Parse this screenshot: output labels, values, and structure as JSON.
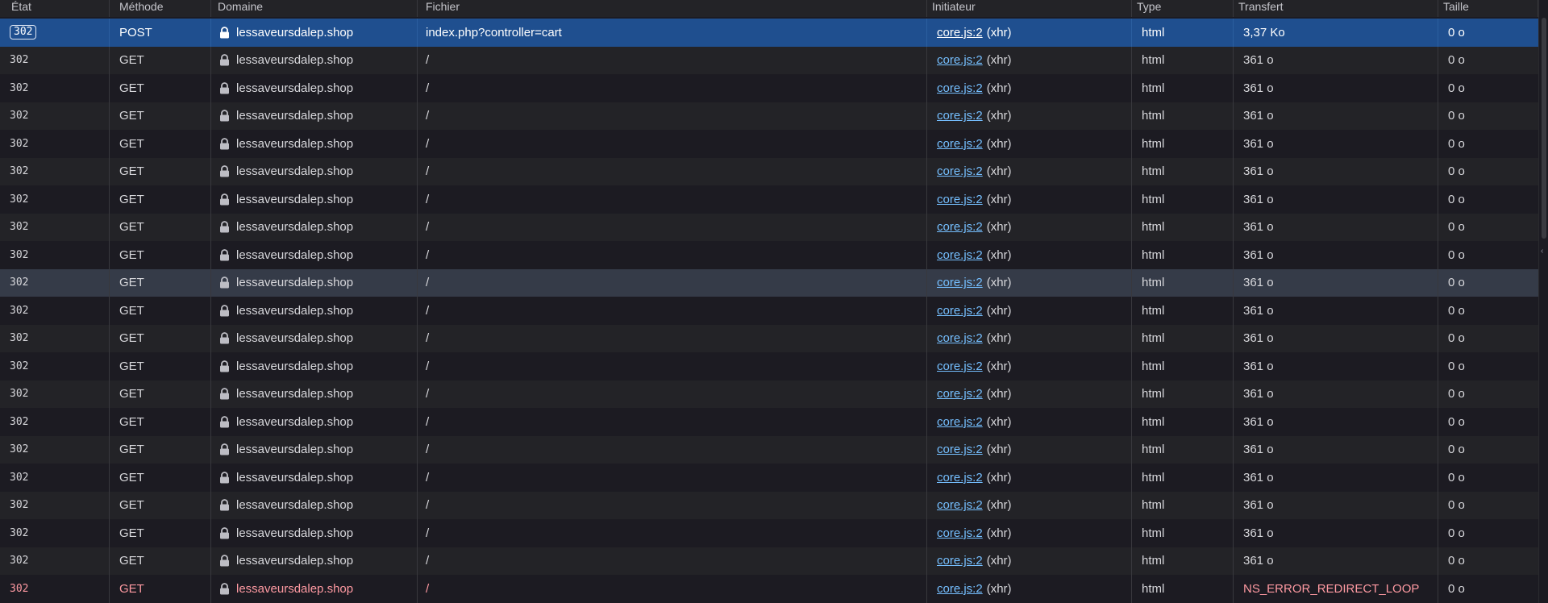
{
  "columns": {
    "status": "État",
    "method": "Méthode",
    "domain": "Domaine",
    "file": "Fichier",
    "initiator": "Initiateur",
    "type": "Type",
    "transfer": "Transfert",
    "size": "Taille"
  },
  "icons": {
    "lock": "lock-icon",
    "scroll_arrow": "chevron-left-icon"
  },
  "colors": {
    "selected_row": "#1f4f8f",
    "link": "#75bfff",
    "error_text": "#ff9aa2"
  },
  "requests": [
    {
      "status": "302",
      "method": "POST",
      "domain": "lessaveursdalep.shop",
      "file": "index.php?controller=cart",
      "initiator_link": "core.js:2",
      "initiator_kind": "(xhr)",
      "type": "html",
      "transfer": "3,37 Ko",
      "size": "0 o",
      "state": "selected"
    },
    {
      "status": "302",
      "method": "GET",
      "domain": "lessaveursdalep.shop",
      "file": "/",
      "initiator_link": "core.js:2",
      "initiator_kind": "(xhr)",
      "type": "html",
      "transfer": "361 o",
      "size": "0 o",
      "state": ""
    },
    {
      "status": "302",
      "method": "GET",
      "domain": "lessaveursdalep.shop",
      "file": "/",
      "initiator_link": "core.js:2",
      "initiator_kind": "(xhr)",
      "type": "html",
      "transfer": "361 o",
      "size": "0 o",
      "state": ""
    },
    {
      "status": "302",
      "method": "GET",
      "domain": "lessaveursdalep.shop",
      "file": "/",
      "initiator_link": "core.js:2",
      "initiator_kind": "(xhr)",
      "type": "html",
      "transfer": "361 o",
      "size": "0 o",
      "state": ""
    },
    {
      "status": "302",
      "method": "GET",
      "domain": "lessaveursdalep.shop",
      "file": "/",
      "initiator_link": "core.js:2",
      "initiator_kind": "(xhr)",
      "type": "html",
      "transfer": "361 o",
      "size": "0 o",
      "state": ""
    },
    {
      "status": "302",
      "method": "GET",
      "domain": "lessaveursdalep.shop",
      "file": "/",
      "initiator_link": "core.js:2",
      "initiator_kind": "(xhr)",
      "type": "html",
      "transfer": "361 o",
      "size": "0 o",
      "state": ""
    },
    {
      "status": "302",
      "method": "GET",
      "domain": "lessaveursdalep.shop",
      "file": "/",
      "initiator_link": "core.js:2",
      "initiator_kind": "(xhr)",
      "type": "html",
      "transfer": "361 o",
      "size": "0 o",
      "state": ""
    },
    {
      "status": "302",
      "method": "GET",
      "domain": "lessaveursdalep.shop",
      "file": "/",
      "initiator_link": "core.js:2",
      "initiator_kind": "(xhr)",
      "type": "html",
      "transfer": "361 o",
      "size": "0 o",
      "state": ""
    },
    {
      "status": "302",
      "method": "GET",
      "domain": "lessaveursdalep.shop",
      "file": "/",
      "initiator_link": "core.js:2",
      "initiator_kind": "(xhr)",
      "type": "html",
      "transfer": "361 o",
      "size": "0 o",
      "state": ""
    },
    {
      "status": "302",
      "method": "GET",
      "domain": "lessaveursdalep.shop",
      "file": "/",
      "initiator_link": "core.js:2",
      "initiator_kind": "(xhr)",
      "type": "html",
      "transfer": "361 o",
      "size": "0 o",
      "state": "hover"
    },
    {
      "status": "302",
      "method": "GET",
      "domain": "lessaveursdalep.shop",
      "file": "/",
      "initiator_link": "core.js:2",
      "initiator_kind": "(xhr)",
      "type": "html",
      "transfer": "361 o",
      "size": "0 o",
      "state": ""
    },
    {
      "status": "302",
      "method": "GET",
      "domain": "lessaveursdalep.shop",
      "file": "/",
      "initiator_link": "core.js:2",
      "initiator_kind": "(xhr)",
      "type": "html",
      "transfer": "361 o",
      "size": "0 o",
      "state": ""
    },
    {
      "status": "302",
      "method": "GET",
      "domain": "lessaveursdalep.shop",
      "file": "/",
      "initiator_link": "core.js:2",
      "initiator_kind": "(xhr)",
      "type": "html",
      "transfer": "361 o",
      "size": "0 o",
      "state": ""
    },
    {
      "status": "302",
      "method": "GET",
      "domain": "lessaveursdalep.shop",
      "file": "/",
      "initiator_link": "core.js:2",
      "initiator_kind": "(xhr)",
      "type": "html",
      "transfer": "361 o",
      "size": "0 o",
      "state": ""
    },
    {
      "status": "302",
      "method": "GET",
      "domain": "lessaveursdalep.shop",
      "file": "/",
      "initiator_link": "core.js:2",
      "initiator_kind": "(xhr)",
      "type": "html",
      "transfer": "361 o",
      "size": "0 o",
      "state": ""
    },
    {
      "status": "302",
      "method": "GET",
      "domain": "lessaveursdalep.shop",
      "file": "/",
      "initiator_link": "core.js:2",
      "initiator_kind": "(xhr)",
      "type": "html",
      "transfer": "361 o",
      "size": "0 o",
      "state": ""
    },
    {
      "status": "302",
      "method": "GET",
      "domain": "lessaveursdalep.shop",
      "file": "/",
      "initiator_link": "core.js:2",
      "initiator_kind": "(xhr)",
      "type": "html",
      "transfer": "361 o",
      "size": "0 o",
      "state": ""
    },
    {
      "status": "302",
      "method": "GET",
      "domain": "lessaveursdalep.shop",
      "file": "/",
      "initiator_link": "core.js:2",
      "initiator_kind": "(xhr)",
      "type": "html",
      "transfer": "361 o",
      "size": "0 o",
      "state": ""
    },
    {
      "status": "302",
      "method": "GET",
      "domain": "lessaveursdalep.shop",
      "file": "/",
      "initiator_link": "core.js:2",
      "initiator_kind": "(xhr)",
      "type": "html",
      "transfer": "361 o",
      "size": "0 o",
      "state": ""
    },
    {
      "status": "302",
      "method": "GET",
      "domain": "lessaveursdalep.shop",
      "file": "/",
      "initiator_link": "core.js:2",
      "initiator_kind": "(xhr)",
      "type": "html",
      "transfer": "361 o",
      "size": "0 o",
      "state": ""
    },
    {
      "status": "302",
      "method": "GET",
      "domain": "lessaveursdalep.shop",
      "file": "/",
      "initiator_link": "core.js:2",
      "initiator_kind": "(xhr)",
      "type": "html",
      "transfer": "NS_ERROR_REDIRECT_LOOP",
      "size": "0 o",
      "state": "error"
    }
  ]
}
